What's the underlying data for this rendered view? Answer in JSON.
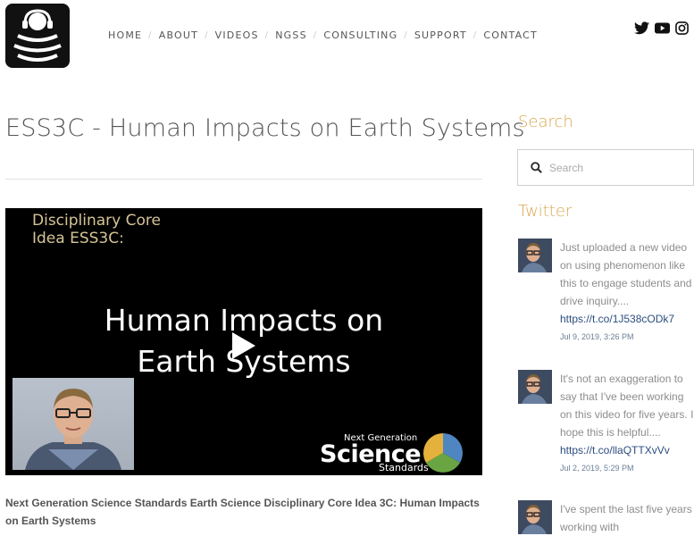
{
  "nav": {
    "items": [
      "HOME",
      "ABOUT",
      "VIDEOS",
      "NGSS",
      "CONSULTING",
      "SUPPORT",
      "CONTACT"
    ]
  },
  "social": [
    "twitter-icon",
    "youtube-icon",
    "instagram-icon"
  ],
  "page": {
    "title": "ESS3C - Human Impacts on Earth Systems"
  },
  "video": {
    "tag_line1": "Disciplinary Core",
    "tag_line2": "Idea ESS3C:",
    "headline_line1": "Human Impacts on",
    "headline_line2": "Earth Systems",
    "ngss_line1": "Next Generation",
    "ngss_line2": "Science",
    "ngss_line3": "Standards"
  },
  "caption": "Next Generation Science Standards Earth Science Disciplinary Core Idea 3C:  Human Impacts on Earth Systems",
  "sidebar": {
    "search_heading": "Search",
    "search_placeholder": "Search",
    "twitter_heading": "Twitter",
    "tweets": [
      {
        "text": "Just uploaded a new video on using phenomenon like this to engage students and drive inquiry....",
        "link": "https://t.co/1J538cODk7",
        "date": "Jul 9, 2019, 3:26 PM"
      },
      {
        "text": "It's not an exaggeration to say that I've been working on this video for five years. I hope this is helpful....",
        "link": "https://t.co/llaQTTXvVv",
        "date": "Jul 2, 2019, 5:29 PM"
      },
      {
        "text": "I've spent the last five years working with",
        "link": "",
        "date": ""
      }
    ]
  },
  "colors": {
    "accent": "#d9a850",
    "link": "#2c4c7f",
    "muted_text": "#8d8d8d"
  }
}
